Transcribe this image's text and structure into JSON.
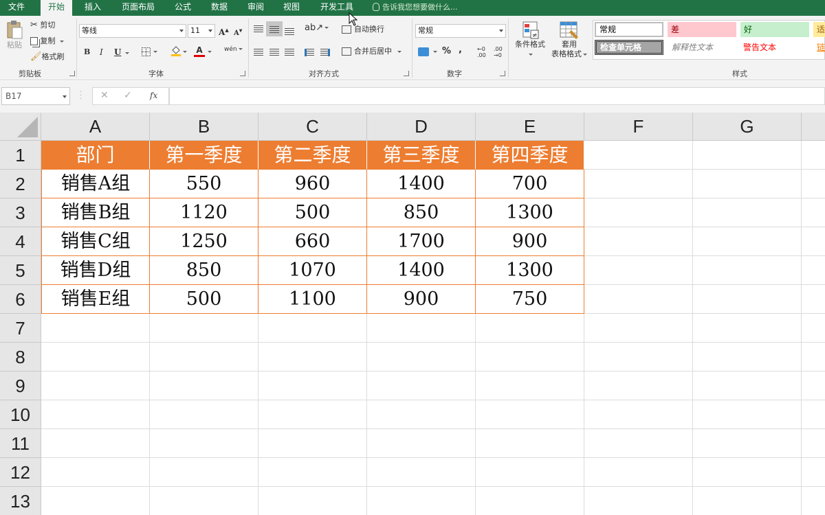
{
  "menu": {
    "tabs": [
      "文件",
      "开始",
      "插入",
      "页面布局",
      "公式",
      "数据",
      "审阅",
      "视图",
      "开发工具"
    ],
    "active": "开始",
    "tell_me": "告诉我您想要做什么..."
  },
  "ribbon": {
    "clipboard": {
      "paste": "粘贴",
      "cut": "剪切",
      "copy": "复制",
      "format_painter": "格式刷",
      "label": "剪贴板"
    },
    "font": {
      "name": "等线",
      "size": "11",
      "label": "字体",
      "phonetic": "wén"
    },
    "alignment": {
      "wrap": "自动换行",
      "merge": "合并后居中",
      "label": "对齐方式"
    },
    "number": {
      "format": "常规",
      "label": "数字"
    },
    "styles": {
      "conditional": "条件格式",
      "table_line1": "套用",
      "table_line2": "表格格式",
      "label": "样式",
      "normal": "常规",
      "bad": "差",
      "good": "好",
      "neutral": "适",
      "check_cell": "检查单元格",
      "explanatory": "解释性文本",
      "warning": "警告文本",
      "linked": "链"
    }
  },
  "formula_bar": {
    "name_box": "B17",
    "formula": ""
  },
  "colors": {
    "accent_green": "#217346",
    "header_orange": "#ed7d31"
  },
  "sheet": {
    "columns": [
      "A",
      "B",
      "C",
      "D",
      "E",
      "F",
      "G"
    ],
    "rows": [
      "1",
      "2",
      "3",
      "4",
      "5",
      "6",
      "7",
      "8",
      "9",
      "10",
      "11",
      "12",
      "13"
    ],
    "table": {
      "headers": [
        "部门",
        "第一季度",
        "第二季度",
        "第三季度",
        "第四季度"
      ],
      "rows": [
        [
          "销售A组",
          "550",
          "960",
          "1400",
          "700"
        ],
        [
          "销售B组",
          "1120",
          "500",
          "850",
          "1300"
        ],
        [
          "销售C组",
          "1250",
          "660",
          "1700",
          "900"
        ],
        [
          "销售D组",
          "850",
          "1070",
          "1400",
          "1300"
        ],
        [
          "销售E组",
          "500",
          "1100",
          "900",
          "750"
        ]
      ]
    }
  }
}
